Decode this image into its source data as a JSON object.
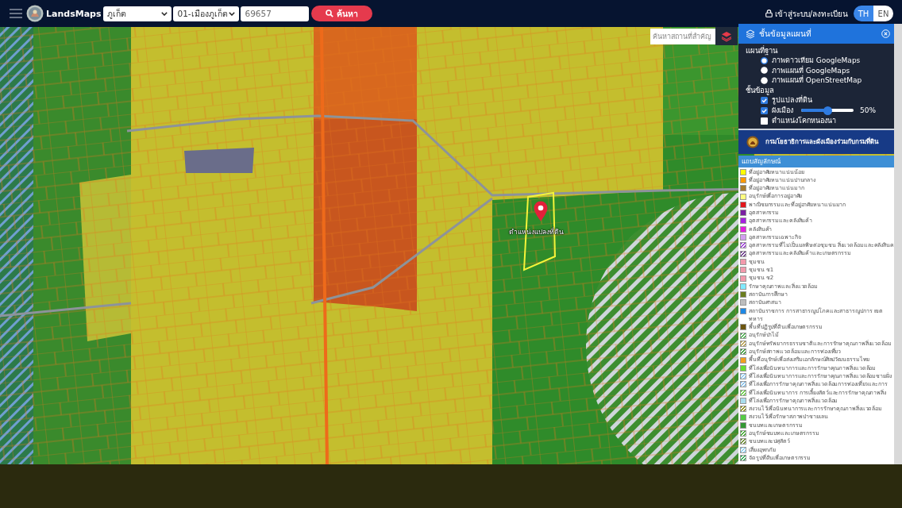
{
  "top_bar": {
    "brand": "LandsMaps",
    "province_select": {
      "value": "ภูเก็ต"
    },
    "district_select": {
      "value": "01-เมืองภูเก็ต"
    },
    "parcel_field": {
      "value": "69657"
    },
    "search_button": "ค้นหา",
    "login_link": "เข้าสู่ระบบ/ลงทะเบียน",
    "languages": [
      {
        "label": "TH",
        "selected": true
      },
      {
        "label": "EN",
        "selected": false
      }
    ]
  },
  "map": {
    "place_search": {
      "placeholder": "ค้นหาสถานที่สำคัญ"
    },
    "marker_label": "ตำแหน่งแปลงที่ดิน"
  },
  "layer_panel": {
    "title": "ชั้นข้อมูลแผนที่",
    "basemap_heading": "แผนที่ฐาน",
    "basemaps": [
      {
        "label": "ภาพดาวเทียม GoogleMaps",
        "selected": true
      },
      {
        "label": "ภาพแผนที่ GoogleMaps",
        "selected": false
      },
      {
        "label": "ภาพแผนที่ OpenStreetMap",
        "selected": false
      }
    ],
    "layers_heading": "ชั้นข้อมูล",
    "layers": [
      {
        "label": "รูปแปลงที่ดิน",
        "kind": "checkbox",
        "checked": true
      },
      {
        "label": "ผังเมือง",
        "kind": "opacity",
        "checked": true,
        "level": 0.5,
        "reading": "50%"
      },
      {
        "label": "ตำแหน่งโคกหนองนา",
        "kind": "checkbox",
        "checked": false
      }
    ],
    "agency_banner": "กรมโยธาธิการและผังเมืองร่วมกับกรมที่ดิน",
    "legend_title": "แถบสัญลักษณ์",
    "legend": [
      {
        "label": "ที่อยู่อาศัยหนาแน่นน้อย",
        "kind": "solid",
        "color": "#ffff00"
      },
      {
        "label": "ที่อยู่อาศัยหนาแน่นปานกลาง",
        "kind": "solid",
        "color": "#ff9900"
      },
      {
        "label": "ที่อยู่อาศัยหนาแน่นมาก",
        "kind": "solid",
        "color": "#a67c2e"
      },
      {
        "label": "อนุรักษ์เพื่อการอยู่อาศัย",
        "kind": "solid",
        "color": "#ffff80"
      },
      {
        "label": "พาณิชยกรรมและที่อยู่อาศัยหนาแน่นมาก",
        "kind": "solid",
        "color": "#e3161b"
      },
      {
        "label": "อุตสาหกรรม",
        "kind": "solid",
        "color": "#7b1fa2"
      },
      {
        "label": "อุตสาหกรรมและคลังสินค้า",
        "kind": "solid",
        "color": "#a51fe0"
      },
      {
        "label": "คลังสินค้า",
        "kind": "solid",
        "color": "#e51ee0"
      },
      {
        "label": "อุตสาหกรรมเฉพาะกิจ",
        "kind": "solid",
        "color": "#d29ef0"
      },
      {
        "label": "อุตสาหกรรมที่ไม่เป็นมลพิษต่อชุมชน สิ่งแวดล้อมและคลังสินค",
        "kind": "hatched",
        "color": "#9c3fd8"
      },
      {
        "label": "อุตสาหกรรมและคลังสินค้าและเกษตรกรรม",
        "kind": "hatched",
        "color": "#6a3a8a"
      },
      {
        "label": "ชุมชน",
        "kind": "solid",
        "color": "#f29aac"
      },
      {
        "label": "ชุมชน ช1",
        "kind": "solid",
        "color": "#f29aac"
      },
      {
        "label": "ชุมชน ช2",
        "kind": "solid",
        "color": "#f29aac"
      },
      {
        "label": "รักษาคุณภาพและสิ่งแวดล้อม",
        "kind": "solid",
        "color": "#80eaff"
      },
      {
        "label": "สถาบันการศึกษา",
        "kind": "solid",
        "color": "#6b7d1e"
      },
      {
        "label": "สถาบันศาสนา",
        "kind": "solid",
        "color": "#bdbdbd"
      },
      {
        "label": "สถาบันราชการ การสาธารณูปโภคและสาธารณูปการ เขตทหาร",
        "kind": "solid",
        "color": "#1e88e5"
      },
      {
        "label": "พื้นที่ปฏิรูปที่ดินเพื่อเกษตรกรรม",
        "kind": "solid",
        "color": "#6b5510"
      },
      {
        "label": "อนุรักษ์ป่าไม้",
        "kind": "hatched",
        "color": "#4caf50"
      },
      {
        "label": "อนุรักษ์ทรัพยากรธรรมชาติและการรักษาคุณภาพสิ่งแวดล้อม",
        "kind": "hatched",
        "color": "#b8a050"
      },
      {
        "label": "อนุรักษ์สภาพแวดล้อมและการท่องเที่ยว",
        "kind": "hatched",
        "color": "#3a9a3a"
      },
      {
        "label": "พื้นที่อนุรักษ์เพื่อส่งเสริมเอกลักษณ์ศิลปวัฒนธรรมไทย",
        "kind": "solid",
        "color": "#f0a020"
      },
      {
        "label": "ที่โล่งเพื่อนันทนาการและการรักษาคุณภาพสิ่งแวดล้อม",
        "kind": "solid",
        "color": "#66dd33"
      },
      {
        "label": "ที่โล่งเพื่อนันทนาการและการรักษาคุณภาพสิ่งแวดล้อมชายฝั่ง",
        "kind": "hatched",
        "color": "#90c8f0"
      },
      {
        "label": "ที่โล่งเพื่อการรักษาคุณภาพสิ่งแวดล้อมการท่องเที่ยวและการ",
        "kind": "hatched",
        "color": "#88c0e8"
      },
      {
        "label": "ที่โล่งเพื่อนันทนาการ การเลี้ยงสัตว์และการรักษาคุณภาพสิ่ง",
        "kind": "hatched",
        "color": "#66cc44"
      },
      {
        "label": "ที่โล่งเพื่อการรักษาคุณภาพสิ่งแวดล้อม",
        "kind": "solid",
        "color": "#a8dcec"
      },
      {
        "label": "สงวนไว้เพื่อนันทนาการและการรักษาคุณภาพสิ่งแวดล้อม",
        "kind": "hatched",
        "color": "#8a8a10"
      },
      {
        "label": "สงวนไว้เพื่อรักษาสภาพป่าชายเลน",
        "kind": "solid",
        "color": "#55cc44"
      },
      {
        "label": "ชนบทและเกษตรกรรม",
        "kind": "solid",
        "color": "#339933"
      },
      {
        "label": "อนุรักษ์ชนบทและเกษตรกรรม",
        "kind": "hatched",
        "color": "#44aa33"
      },
      {
        "label": "ชนบทและปศุสัตว์",
        "kind": "hatched",
        "color": "#6a8a30"
      },
      {
        "label": "เสี่ยงอุทกภัย",
        "kind": "hatched",
        "color": "#90d0f0"
      },
      {
        "label": "จัดรูปที่ดินเพื่อเกษตรกรรม",
        "kind": "hatched",
        "color": "#33aa55"
      }
    ]
  }
}
